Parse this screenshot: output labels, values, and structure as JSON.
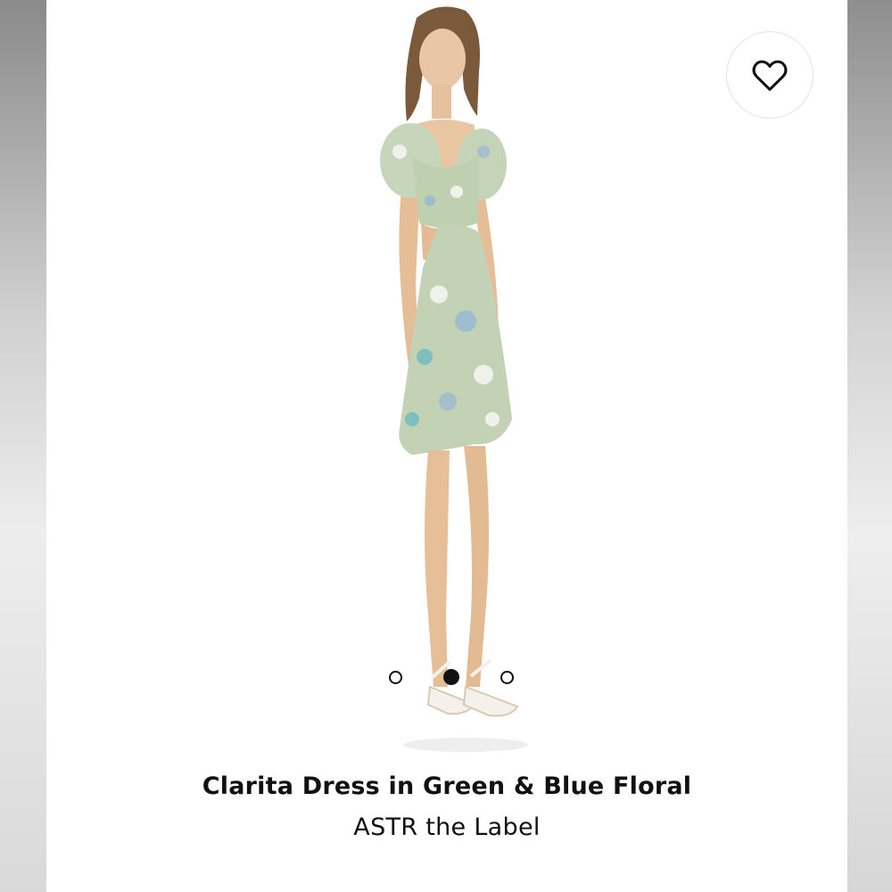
{
  "product": {
    "title": "Clarita Dress in Green & Blue Floral",
    "brand": "ASTR the Label",
    "image_subject": "model wearing floral mini dress",
    "dress_colors": {
      "base": "#bfd0b0",
      "accent_blue": "#8fb3d9",
      "accent_teal": "#4fb0c6",
      "accent_white": "#eef2ea"
    }
  },
  "favorite": {
    "icon": "heart-outline-icon"
  },
  "carousel": {
    "total": 3,
    "active_index": 1
  },
  "colors": {
    "background": "#ffffff",
    "text": "#111111",
    "side_bars": "#cfcfcf"
  }
}
